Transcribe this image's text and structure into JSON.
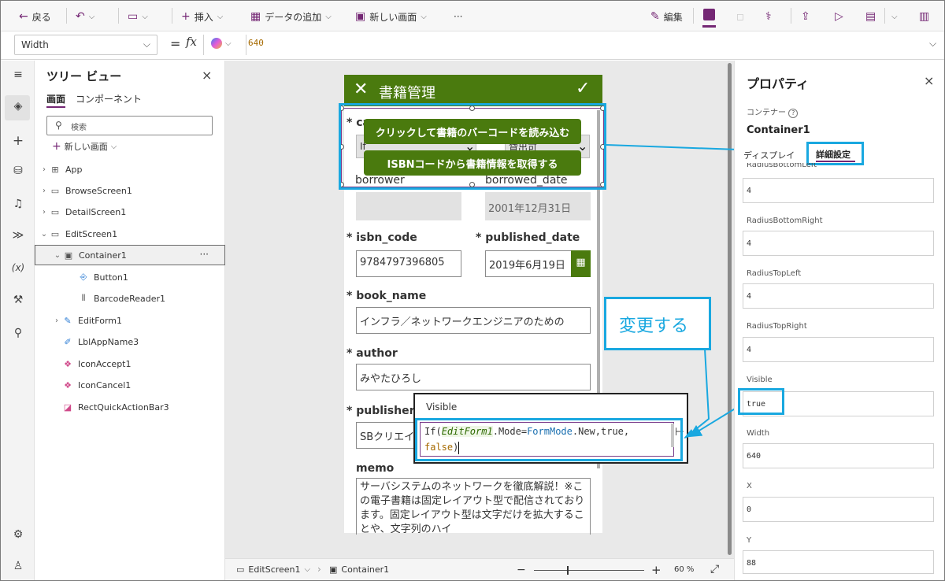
{
  "command_bar": {
    "back": "戻る",
    "insert": "挿入",
    "add_data": "データの追加",
    "new_screen": "新しい画面",
    "more": "···",
    "edit": "編集"
  },
  "formula_bar": {
    "property": "Width",
    "equals": "=",
    "fx": "fx",
    "value": "640"
  },
  "tree": {
    "title": "ツリー ビュー",
    "tab_screens": "画面",
    "tab_components": "コンポーネント",
    "search_placeholder": "検索",
    "new_screen": "新しい画面",
    "nodes": [
      "App",
      "BrowseScreen1",
      "DetailScreen1",
      "EditScreen1",
      "Container1",
      "Button1",
      "BarcodeReader1",
      "EditForm1",
      "LblAppName3",
      "IconAccept1",
      "IconCancel1",
      "RectQuickActionBar3"
    ],
    "more": "···"
  },
  "app": {
    "title": "書籍管理",
    "btn_scan": "クリックして書籍のバーコードを読み込む",
    "btn_isbn": "ISBNコードから書籍情報を取得する",
    "partial_label": "ca",
    "field_if": "If",
    "field_checkout": "貸出可",
    "borrower": "borrower",
    "borrowed_date": "borrowed_date",
    "borrowed_value": "2001年12月31日",
    "isbn_label": "isbn_code",
    "isbn_value": "9784797396805",
    "pub_label": "published_date",
    "pub_value": "2019年6月19日",
    "book_label": "book_name",
    "book_value": "インフラ／ネットワークエンジニアのための",
    "author_label": "author",
    "author_value": "みやたひろし",
    "publisher_label": "publisher",
    "publisher_value": "SBクリエイ",
    "memo_label": "memo",
    "memo_value": "サーバシステムのネットワークを徹底解説！※この電子書籍は固定レイアウト型で配信されております。固定レイアウト型は文字だけを拡大することや、文字列のハイ",
    "required": "*"
  },
  "visible_popup": {
    "title": "Visible",
    "f_if": "If(",
    "f_form": "EditForm1",
    "f_mode": ".Mode=",
    "f_formmode": "FormMode",
    "f_new": ".New,true,",
    "f_false": "false",
    "f_close": ")"
  },
  "annotation": "変更する",
  "properties": {
    "title": "プロパティ",
    "type": "コンテナー",
    "name": "Container1",
    "tab_display": "ディスプレイ",
    "tab_advanced": "詳細設定",
    "items": [
      {
        "label": "RadiusBottomLeft",
        "value": "4"
      },
      {
        "label": "RadiusBottomRight",
        "value": "4"
      },
      {
        "label": "RadiusTopLeft",
        "value": "4"
      },
      {
        "label": "RadiusTopRight",
        "value": "4"
      },
      {
        "label": "Visible",
        "value": "true"
      },
      {
        "label": "Width",
        "value": "640"
      },
      {
        "label": "X",
        "value": "0"
      },
      {
        "label": "Y",
        "value": "88"
      }
    ]
  },
  "status": {
    "screen": "EditScreen1",
    "container": "Container1",
    "minus": "−",
    "plus": "+",
    "zoom": "60",
    "percent": "%"
  },
  "colors": {
    "accent": "#742774",
    "green": "#4a7a0e",
    "callout": "#19a8e0"
  }
}
